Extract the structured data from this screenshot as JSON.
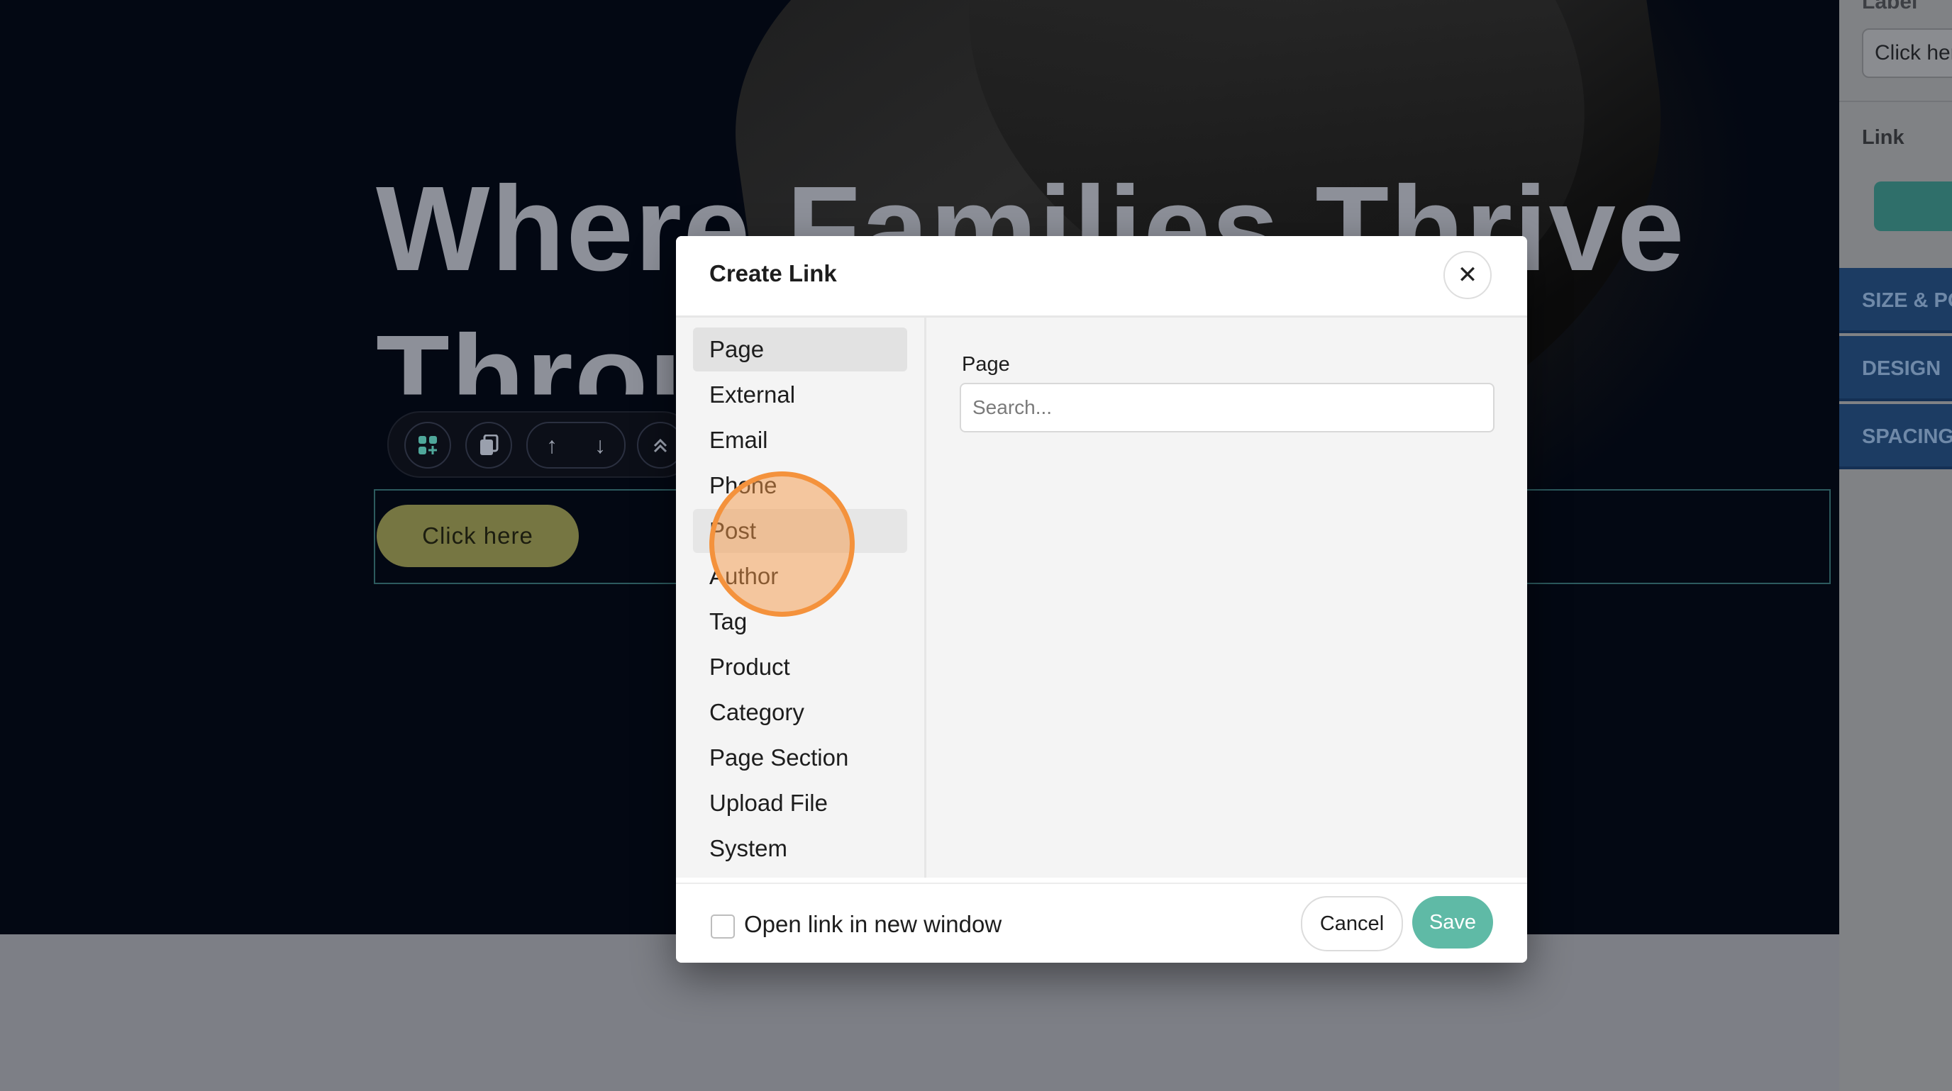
{
  "hero": {
    "title_line1": "Where Families Thrive",
    "title_line2": "Throu",
    "button_label": "Click here"
  },
  "block_toolbar": {
    "icons": [
      "add-block-icon",
      "duplicate-icon",
      "arrow-up-icon",
      "arrow-down-icon",
      "collapse-up-icon"
    ]
  },
  "side_panel": {
    "label_heading": "Label",
    "label_value": "Click here",
    "link_heading": "Link",
    "tabs": [
      "SIZE & POSITION",
      "DESIGN",
      "SPACING"
    ]
  },
  "modal": {
    "title": "Create Link",
    "close_icon": "close-icon",
    "nav_items": [
      "Page",
      "External",
      "Email",
      "Phone",
      "Post",
      "Author",
      "Tag",
      "Product",
      "Category",
      "Page Section",
      "Upload File",
      "System"
    ],
    "active_item": "Page",
    "hovered_item": "Post",
    "content_label": "Page",
    "search_placeholder": "Search...",
    "new_window_label": "Open link in new window",
    "new_window_checked": false,
    "cancel_label": "Cancel",
    "save_label": "Save"
  },
  "colors": {
    "accent": "#5fbaa6",
    "hero_button": "#767642",
    "side_tab": "#1c3c63",
    "click_indicator": "#f4923c"
  }
}
